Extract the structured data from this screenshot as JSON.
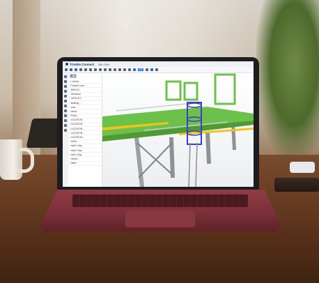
{
  "scene": {
    "colors": {
      "laptop_lid": "#1d1d1f",
      "laptop_base": "#7a2f37",
      "desk": "#5c331c",
      "steel_green": "#6cc14a",
      "steel_grey": "#9aa0a6",
      "ladder_blue": "#3d3fc2",
      "walkway_yellow": "#f0c419"
    }
  },
  "app": {
    "brand": "Trimble Connect",
    "project": "BM 2000",
    "toolbar_badge": "999",
    "panel_title": "模型",
    "tree": [
      "< 4 items",
      "› Trimble Conn...",
      "› BM1012...",
      "› Structural",
      "  › 3/4 BUILT...",
      "  › Building ...",
      "    › Arch...",
      "    › Struct...",
      "      › DUAL...",
      "      › LOCATION...",
      "      › LOCATION...",
      "      › LOCATION...",
      "      › LOCATION...",
      "      › LOCATION...",
      "› DUAL...",
      "› cube 1 day",
      "› cube 2 day",
      "› cube 3 day",
      "› Yellow...",
      "› Items"
    ]
  }
}
